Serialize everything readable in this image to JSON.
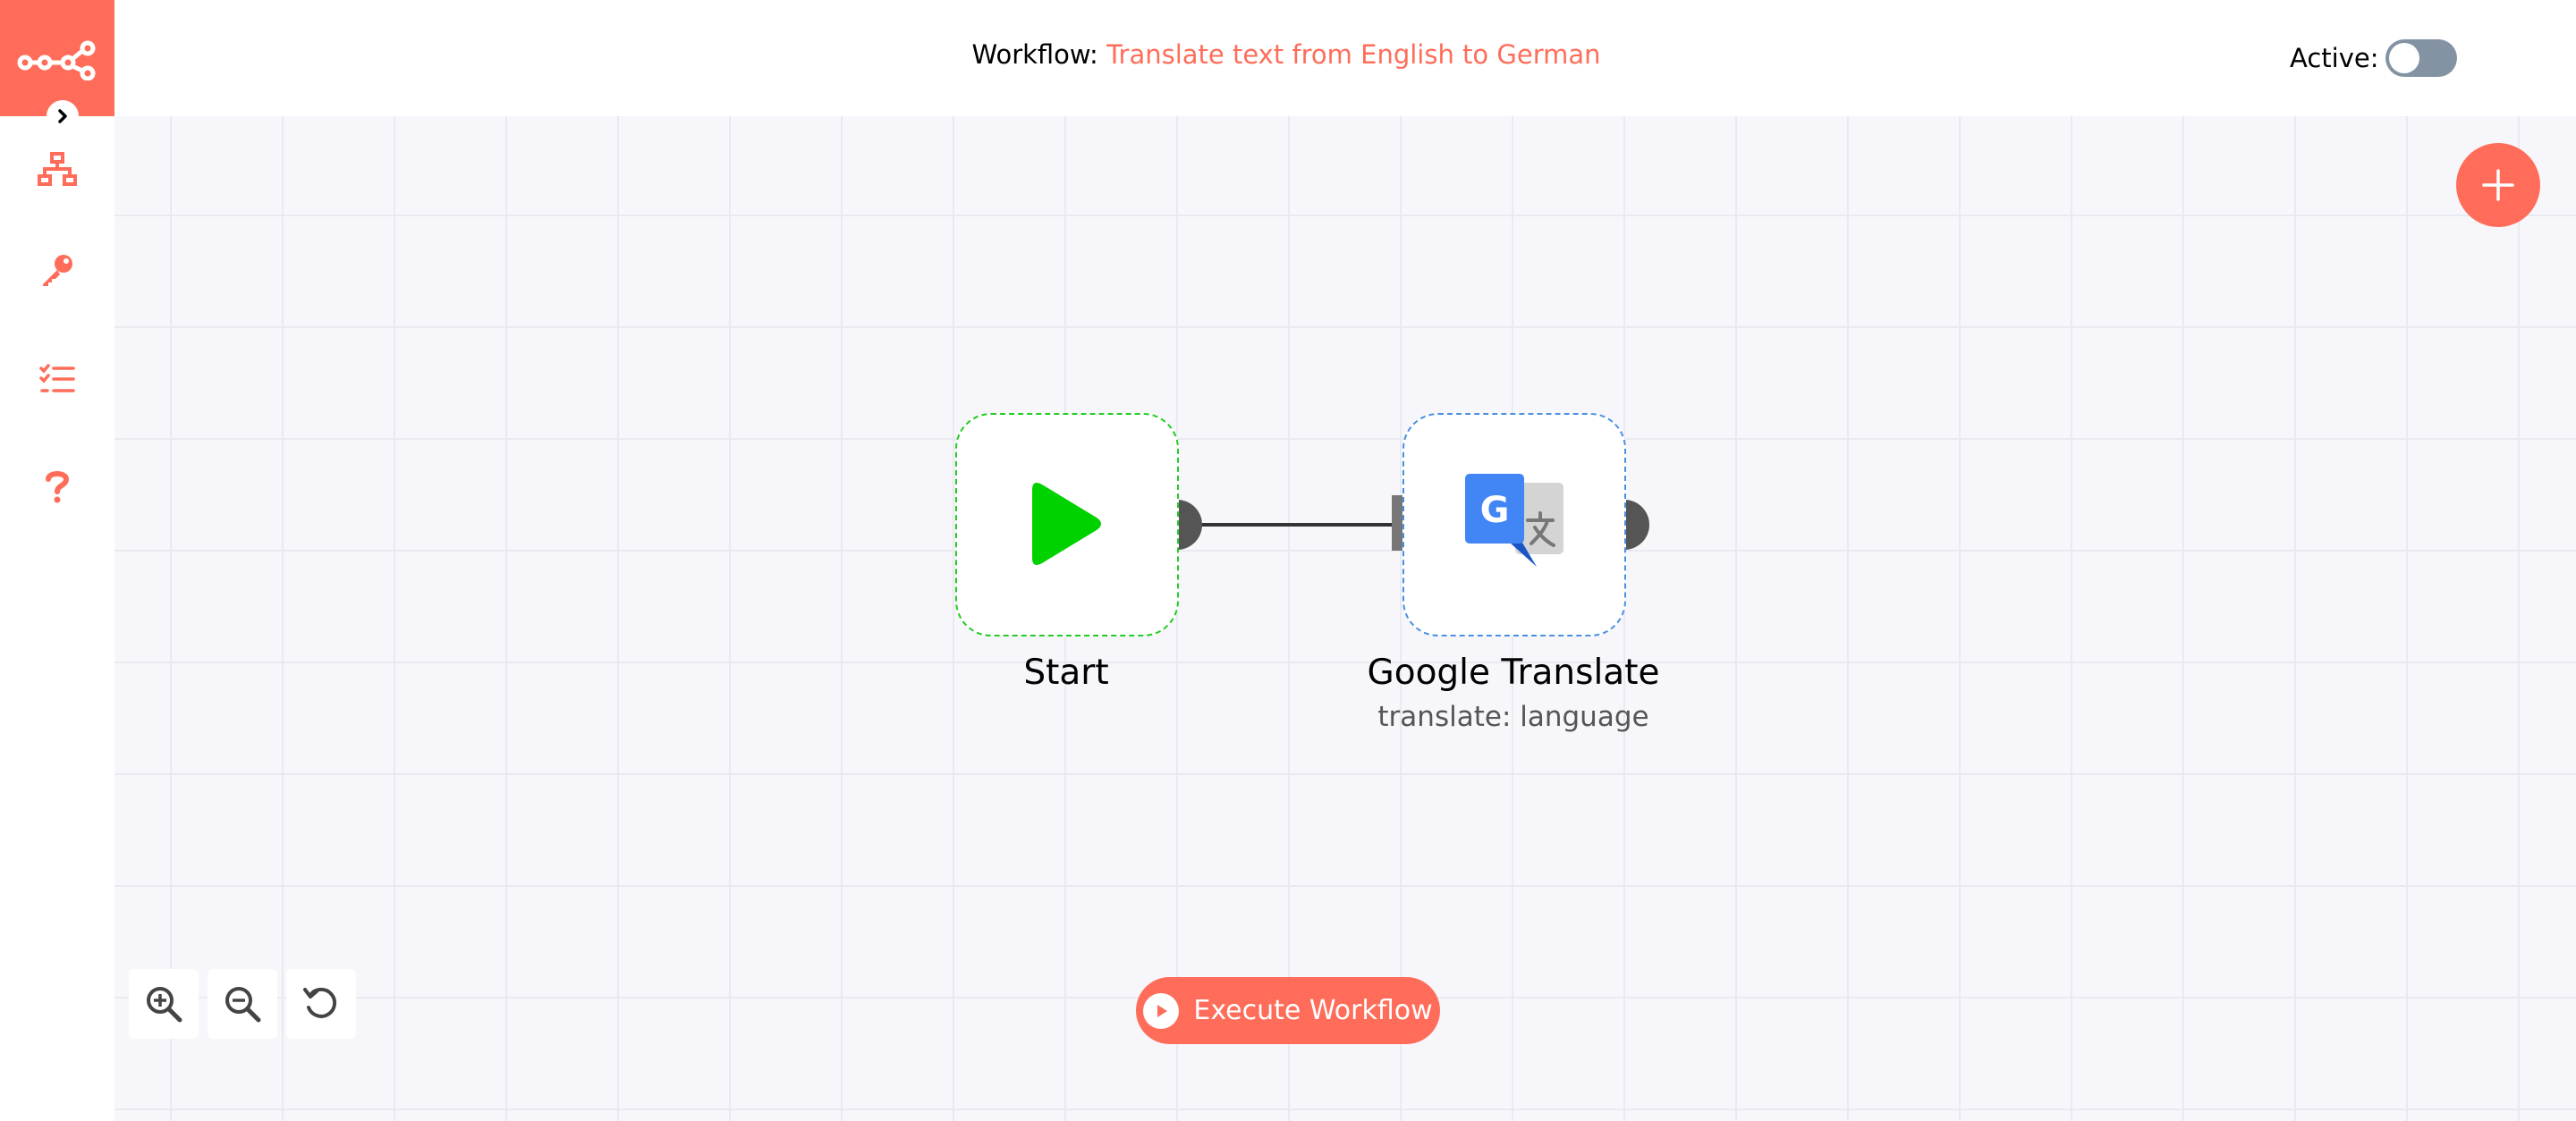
{
  "header": {
    "workflow_prefix": "Workflow:",
    "workflow_name": "Translate text from English to German",
    "active_label": "Active:",
    "active": false
  },
  "sidebar": {
    "logo_icon": "n8n-logo-icon",
    "items": [
      {
        "icon": "workflow-icon"
      },
      {
        "icon": "key-icon"
      },
      {
        "icon": "executions-list-icon"
      },
      {
        "icon": "help-icon"
      }
    ]
  },
  "nodes": [
    {
      "name": "Start",
      "subtitle": "",
      "icon": "play-icon"
    },
    {
      "name": "Google Translate",
      "subtitle": "translate: language",
      "icon": "google-translate-icon"
    }
  ],
  "zoom_controls": [
    "zoom-in-icon",
    "zoom-out-icon",
    "reset-zoom-icon"
  ],
  "execute_button": {
    "label": "Execute Workflow"
  },
  "colors": {
    "accent": "#ff6d5a",
    "start_border": "#22cc22",
    "translate_border": "#4a90e2"
  }
}
